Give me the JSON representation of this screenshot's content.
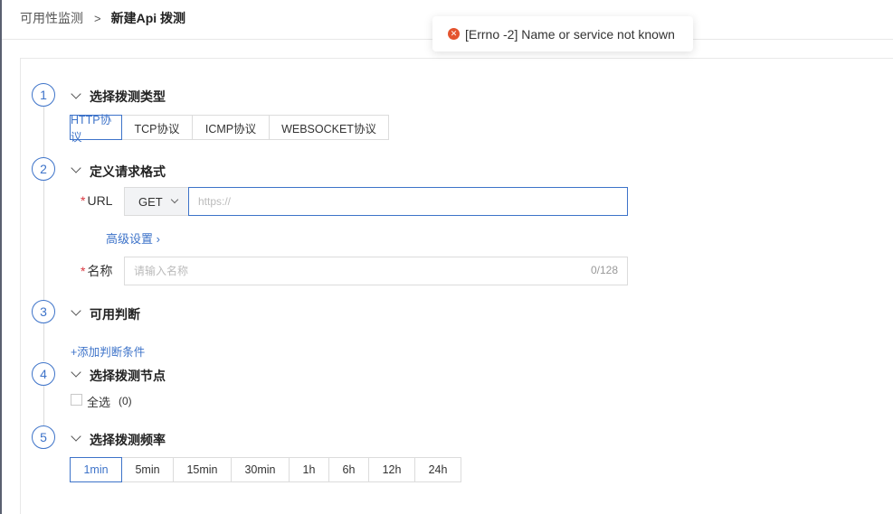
{
  "breadcrumb": {
    "parent": "可用性监测",
    "separator": ">",
    "current": "新建Api 拨测"
  },
  "toast": {
    "icon": "error-circle-icon",
    "message": "[Errno -2] Name or service not known",
    "color": "#e4542f"
  },
  "steps": [
    {
      "number": "1",
      "title": "选择拨测类型"
    },
    {
      "number": "2",
      "title": "定义请求格式"
    },
    {
      "number": "3",
      "title": "可用判断"
    },
    {
      "number": "4",
      "title": "选择拨测节点"
    },
    {
      "number": "5",
      "title": "选择拨测频率"
    }
  ],
  "protocols": {
    "options": [
      "HTTP协议",
      "TCP协议",
      "ICMP协议",
      "WEBSOCKET协议"
    ],
    "selected": "HTTP协议"
  },
  "request": {
    "required_mark": "*",
    "url_label": "URL",
    "method": "GET",
    "url_placeholder": "https://",
    "advanced_link": "高级设置 ›",
    "name_label": "名称",
    "name_placeholder": "请输入名称",
    "name_count": "0/128"
  },
  "judgement": {
    "add_condition": "+添加判断条件"
  },
  "nodes": {
    "select_all_label": "全选",
    "count": "(0)",
    "select_all_checked": false
  },
  "frequency": {
    "options": [
      "1min",
      "5min",
      "15min",
      "30min",
      "1h",
      "6h",
      "12h",
      "24h"
    ],
    "selected": "1min"
  },
  "colors": {
    "accent": "#3d73c9",
    "required": "#d9363e",
    "error": "#e4542f"
  }
}
